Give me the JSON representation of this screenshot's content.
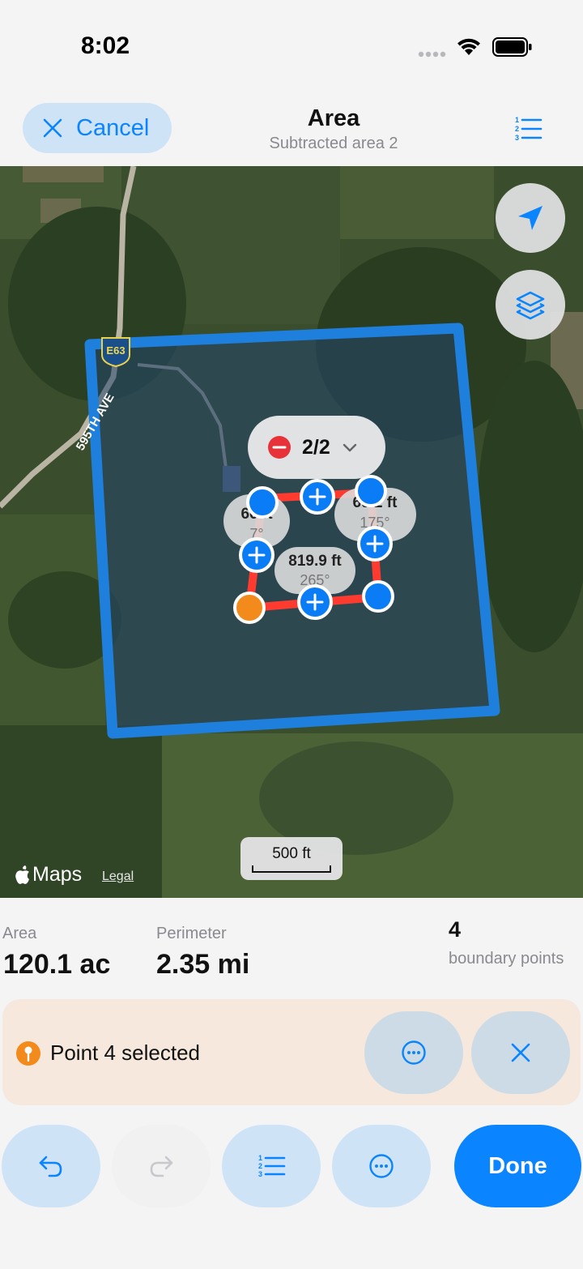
{
  "status_bar": {
    "time": "8:02"
  },
  "nav": {
    "cancel_label": "Cancel",
    "title": "Area",
    "subtitle": "Subtracted area 2",
    "icons": {
      "cancel": "close-icon",
      "list": "numbered-list-icon"
    }
  },
  "map": {
    "road_shield": "E63",
    "road_name": "595TH AVE",
    "shape_selector": {
      "count": "2/2",
      "icons": [
        "remove-icon",
        "chevron-down-icon"
      ]
    },
    "segments": [
      {
        "length": "66 ft",
        "angle": "7°"
      },
      {
        "length": "69 2 ft",
        "angle": "175°"
      },
      {
        "length": "819.9 ft",
        "angle": "265°"
      }
    ],
    "scale_label": "500 ft",
    "attribution": "Maps",
    "legal_label": "Legal",
    "colors": {
      "outer_boundary": "#1e7fdc",
      "subtracted_boundary": "#ff3b30",
      "vertex": "#0a7cf5",
      "selected_vertex": "#f28a1c"
    }
  },
  "stats": {
    "area_label": "Area",
    "area_value": "120.1 ac",
    "perimeter_label": "Perimeter",
    "perimeter_value": "2.35 mi",
    "points_count": "4",
    "points_label": "boundary points"
  },
  "selection": {
    "text": "Point 4 selected",
    "icons": [
      "pin-icon",
      "more-icon",
      "close-icon"
    ]
  },
  "toolbar": {
    "done_label": "Done",
    "icons": [
      "undo-icon",
      "redo-icon",
      "numbered-list-icon",
      "more-icon"
    ]
  }
}
